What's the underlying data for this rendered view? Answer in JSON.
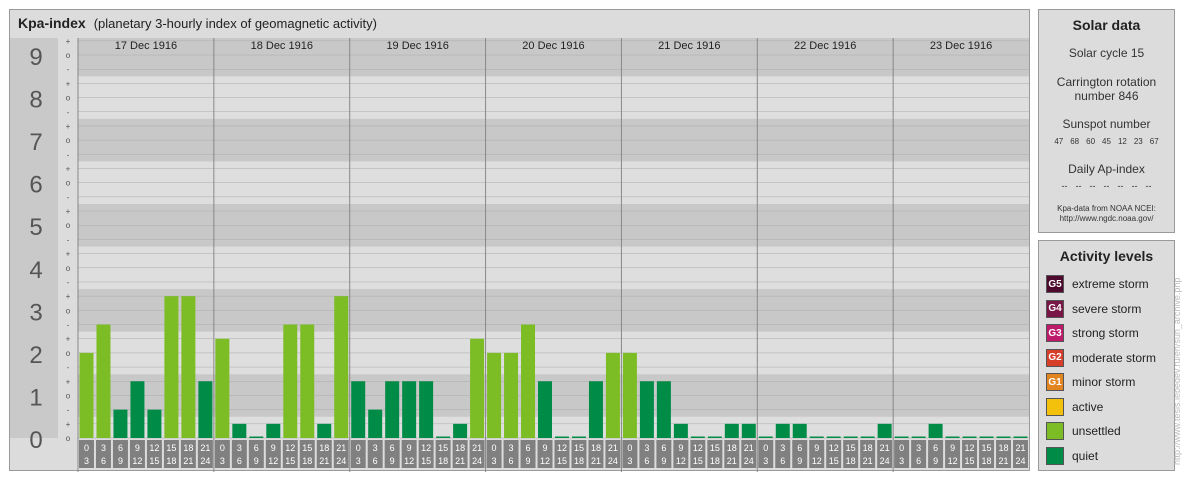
{
  "header": {
    "title": "Kpa-index",
    "subtitle": "(planetary 3-hourly index of geomagnetic activity)"
  },
  "chart_data": {
    "type": "bar",
    "title": "Kpa-index",
    "subtitle": "(planetary 3-hourly index of geomagnetic activity)",
    "ylim": [
      0,
      9
    ],
    "y_ticks": [
      "0",
      "1",
      "2",
      "3",
      "4",
      "5",
      "6",
      "7",
      "8",
      "9"
    ],
    "minor_tick_labels": [
      "+",
      "o",
      "-"
    ],
    "days": [
      "17 Dec 1916",
      "18 Dec 1916",
      "19 Dec 1916",
      "20 Dec 1916",
      "21 Dec 1916",
      "22 Dec 1916",
      "23 Dec 1916"
    ],
    "interval_labels": [
      [
        "0",
        "3"
      ],
      [
        "3",
        "6"
      ],
      [
        "6",
        "9"
      ],
      [
        "9",
        "12"
      ],
      [
        "12",
        "15"
      ],
      [
        "15",
        "18"
      ],
      [
        "18",
        "21"
      ],
      [
        "21",
        "24"
      ]
    ],
    "series": [
      {
        "day": "17 Dec 1916",
        "values": [
          2.0,
          2.667,
          0.667,
          1.333,
          0.667,
          3.333,
          3.333,
          1.333
        ]
      },
      {
        "day": "18 Dec 1916",
        "values": [
          2.333,
          0.333,
          0.0,
          0.333,
          2.667,
          2.667,
          0.333,
          3.333
        ]
      },
      {
        "day": "19 Dec 1916",
        "values": [
          1.333,
          0.667,
          1.333,
          1.333,
          1.333,
          0.0,
          0.333,
          2.333
        ]
      },
      {
        "day": "20 Dec 1916",
        "values": [
          2.0,
          2.0,
          2.667,
          1.333,
          0.0,
          0.0,
          1.333,
          2.0
        ]
      },
      {
        "day": "21 Dec 1916",
        "values": [
          2.0,
          1.333,
          1.333,
          0.333,
          0.0,
          0.0,
          0.333,
          0.333
        ]
      },
      {
        "day": "22 Dec 1916",
        "values": [
          0.0,
          0.333,
          0.333,
          0.0,
          0.0,
          0.0,
          0.0,
          0.333
        ]
      },
      {
        "day": "23 Dec 1916",
        "values": [
          0.0,
          0.0,
          0.333,
          0.0,
          0.0,
          0.0,
          0.0,
          0.0
        ]
      }
    ],
    "colors": {
      "quiet": "#008c46",
      "unsettled": "#7cbd25"
    },
    "grid": true
  },
  "solar": {
    "title": "Solar data",
    "cycle": "Solar cycle 15",
    "carrington_line1": "Carrington rotation",
    "carrington_line2": "number 846",
    "sunspot_title": "Sunspot number",
    "sunspots": [
      "47",
      "68",
      "60",
      "45",
      "12",
      "23",
      "67"
    ],
    "ap_title": "Daily Ap-index",
    "ap_values": [
      "--",
      "--",
      "--",
      "--",
      "--",
      "--",
      "--"
    ],
    "credit_line1": "Kpa-data from NOAA NCEI:",
    "credit_line2": "http://www.ngdc.noaa.gov/"
  },
  "activity": {
    "title": "Activity levels",
    "levels": [
      {
        "badge": "G5",
        "label": "extreme storm",
        "color": "#4d0a2e"
      },
      {
        "badge": "G4",
        "label": "severe storm",
        "color": "#7a1547"
      },
      {
        "badge": "G3",
        "label": "strong storm",
        "color": "#bd1a6b"
      },
      {
        "badge": "G2",
        "label": "moderate storm",
        "color": "#d73e2a"
      },
      {
        "badge": "G1",
        "label": "minor storm",
        "color": "#e2841f"
      },
      {
        "badge": "",
        "label": "active",
        "color": "#f3c10b"
      },
      {
        "badge": "",
        "label": "unsettled",
        "color": "#7cbd25"
      },
      {
        "badge": "",
        "label": "quiet",
        "color": "#008c46"
      }
    ]
  },
  "watermark": "http://www.tesis.lebedev.ru/en/sun_archive.php"
}
